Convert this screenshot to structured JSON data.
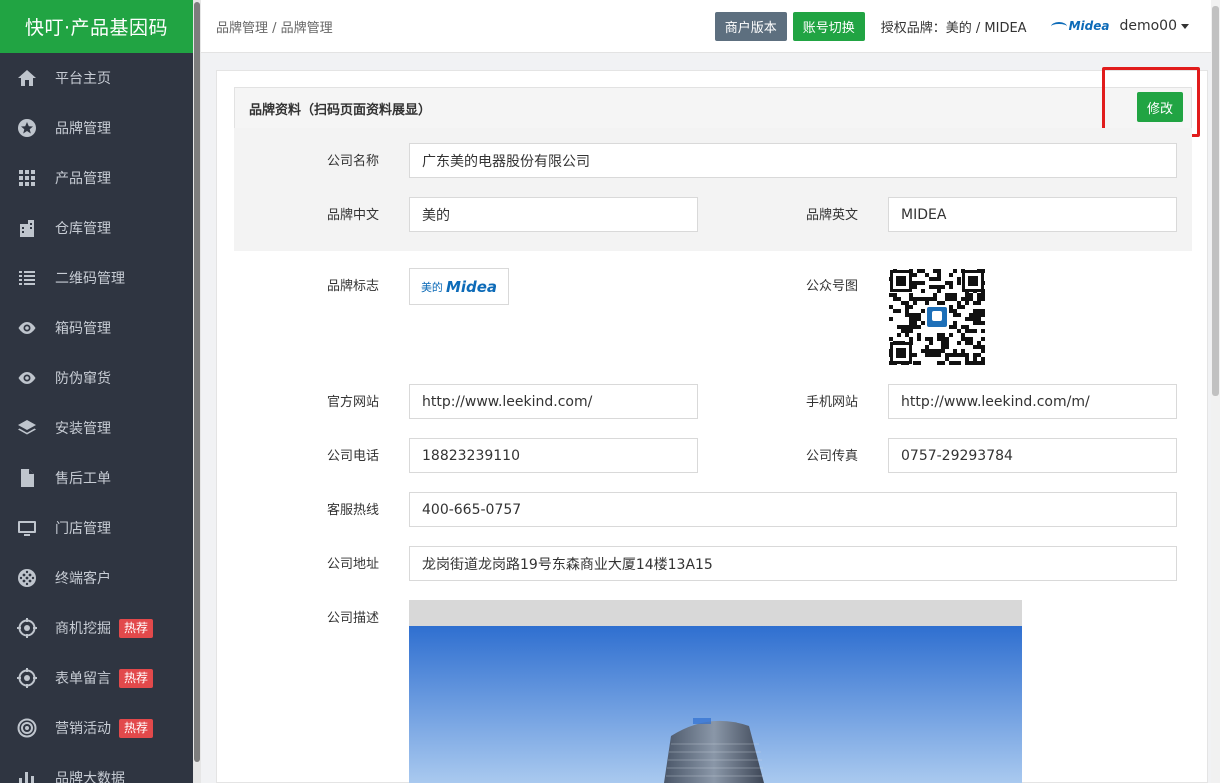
{
  "app": {
    "title": "快叮·产品基因码"
  },
  "sidebar": {
    "items": [
      {
        "label": "平台主页",
        "icon": "home-icon",
        "hot": ""
      },
      {
        "label": "品牌管理",
        "icon": "star-icon",
        "hot": ""
      },
      {
        "label": "产品管理",
        "icon": "grid-icon",
        "hot": ""
      },
      {
        "label": "仓库管理",
        "icon": "building-icon",
        "hot": ""
      },
      {
        "label": "二维码管理",
        "icon": "qrcode-list-icon",
        "hot": ""
      },
      {
        "label": "箱码管理",
        "icon": "eye-icon",
        "hot": ""
      },
      {
        "label": "防伪窜货",
        "icon": "eye-icon",
        "hot": ""
      },
      {
        "label": "安装管理",
        "icon": "layers-icon",
        "hot": ""
      },
      {
        "label": "售后工单",
        "icon": "file-icon",
        "hot": ""
      },
      {
        "label": "门店管理",
        "icon": "monitor-icon",
        "hot": ""
      },
      {
        "label": "终端客户",
        "icon": "globe-icon",
        "hot": ""
      },
      {
        "label": "商机挖掘",
        "icon": "target-icon",
        "hot": "热荐"
      },
      {
        "label": "表单留言",
        "icon": "target-icon",
        "hot": "热荐"
      },
      {
        "label": "营销活动",
        "icon": "broadcast-icon",
        "hot": "热荐"
      },
      {
        "label": "品牌大数据",
        "icon": "bar-chart-icon",
        "hot": ""
      }
    ]
  },
  "header": {
    "breadcrumb": "品牌管理 / 品牌管理",
    "merchant_version": "商户版本",
    "switch_account": "账号切换",
    "authorized_brand": "授权品牌：美的 / MIDEA",
    "logo_text": "Midea",
    "username": "demo00"
  },
  "card": {
    "title": "品牌资料（扫码页面资料展显）",
    "edit_label": "修改"
  },
  "form": {
    "company_name_label": "公司名称",
    "company_name": "广东美的电器股份有限公司",
    "brand_cn_label": "品牌中文",
    "brand_cn": "美的",
    "brand_en_label": "品牌英文",
    "brand_en": "MIDEA",
    "logo_label": "品牌标志",
    "logo_cn": "美的",
    "logo_en": "Midea",
    "wechat_label": "公众号图",
    "website_label": "官方网站",
    "website": "http://www.leekind.com/",
    "mobile_site_label": "手机网站",
    "mobile_site": "http://www.leekind.com/m/",
    "phone_label": "公司电话",
    "phone": "18823239110",
    "fax_label": "公司传真",
    "fax": "0757-29293784",
    "hotline_label": "客服热线",
    "hotline": "400-665-0757",
    "address_label": "公司地址",
    "address": "龙岗街道龙岗路19号东森商业大厦14楼13A15",
    "desc_label": "公司描述"
  },
  "colors": {
    "brand_green": "#21a443",
    "sidebar_bg": "#2f3541",
    "hot_red": "#e2494b",
    "highlight_red": "#e11c1c",
    "merchant_button": "#5d6f7f"
  }
}
